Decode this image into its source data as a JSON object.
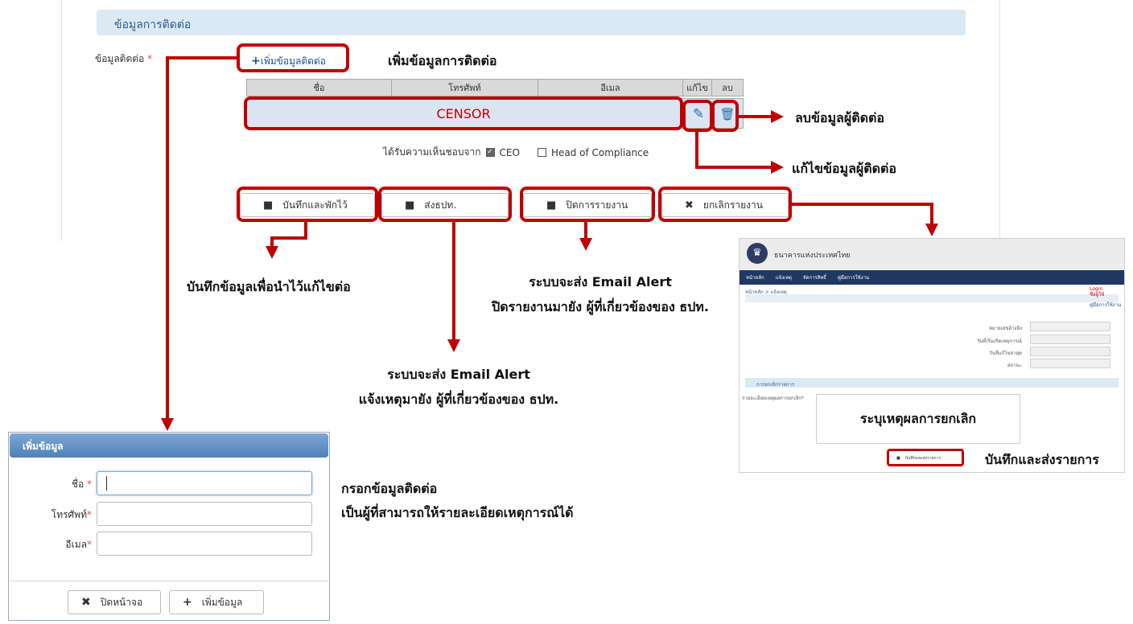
{
  "section": {
    "title": "ข้อมูลการติดต่อ"
  },
  "contact_field": {
    "label": "ข้อมูลติดต่อ",
    "required_mark": "*",
    "add_link": "เพิ่มข้อมูลติดต่อ"
  },
  "table": {
    "columns": [
      "ชื่อ",
      "โทรศัพท์",
      "อีเมล",
      "แก้ไข",
      "ลบ"
    ],
    "row_text": "CENSOR"
  },
  "approval": {
    "label": "ได้รับความเห็นชอบจาก",
    "options": [
      {
        "label": "CEO",
        "checked": true
      },
      {
        "label": "Head of Compliance",
        "checked": false
      }
    ]
  },
  "buttons": {
    "save_draft": "บันทึกและพักไว้",
    "send": "ส่งธปท.",
    "close_report": "ปิดการรายงาน",
    "cancel_report": "ยกเลิกรายงาน"
  },
  "annotations": {
    "add_contact": "เพิ่มข้อมูลการติดต่อ",
    "delete_contact": "ลบข้อมูลผู้ติดต่อ",
    "edit_contact": "แก้ไขข้อมูลผู้ติดต่อ",
    "save_draft": "บันทึกข้อมูลเพื่อนำไว้แก้ไขต่อ",
    "close_alert_1": "ระบบจะส่ง Email Alert",
    "close_alert_2": "ปิดรายงานมายัง ผู้ที่เกี่ยวข้องของ ธปท.",
    "send_alert_1": "ระบบจะส่ง Email Alert",
    "send_alert_2": "แจ้งเหตุมายัง ผู้ที่เกี่ยวข้องของ ธปท.",
    "fill_contact_1": "กรอกข้อมูลติดต่อ",
    "fill_contact_2": "เป็นผู้ที่สามารถให้รายละเอียดเหตุการณ์ได้",
    "cancel_reason": "ระบุเหตุผลการยกเลิก",
    "save_and_send": "บันทึกและส่งรายการ"
  },
  "modal": {
    "title": "เพิ่มข้อมูล",
    "fields": [
      {
        "label": "ชื่อ",
        "value": ""
      },
      {
        "label": "โทรศัพท์",
        "value": ""
      },
      {
        "label": "อีเมล",
        "value": ""
      }
    ],
    "close_button": "ปิดหน้าจอ",
    "add_button": "เพิ่มข้อมูล"
  },
  "cancel_screen": {
    "bank_name": "ธนาคารแห่งประเทศไทย",
    "nav": [
      "หน้าหลัก",
      "แจ้งเหตุ",
      "จัดการสิทธิ์",
      "คู่มือการใช้งาน"
    ],
    "breadcrumb": "หน้าหลัก > แจ้งเหตุ",
    "login": "Login",
    "user": "ชื่อผู้ใช้",
    "manual": "คู่มือการใช้งาน",
    "fields": [
      "หมายเลขอ้างอิง",
      "วันที่เริ่มเกิดเหตุการณ์",
      "วันที่แก้ไขล่าสุด",
      "สถานะ"
    ],
    "section_title": "การยกเลิกรายการ",
    "reason_label": "รายละเอียดเหตุผลการยกเลิก*",
    "save_button": "บันทึกและส่งรายการ"
  },
  "colors": {
    "highlight": "#c00000",
    "accent": "#1f4e8c",
    "section_bg": "#dbe9f4"
  }
}
